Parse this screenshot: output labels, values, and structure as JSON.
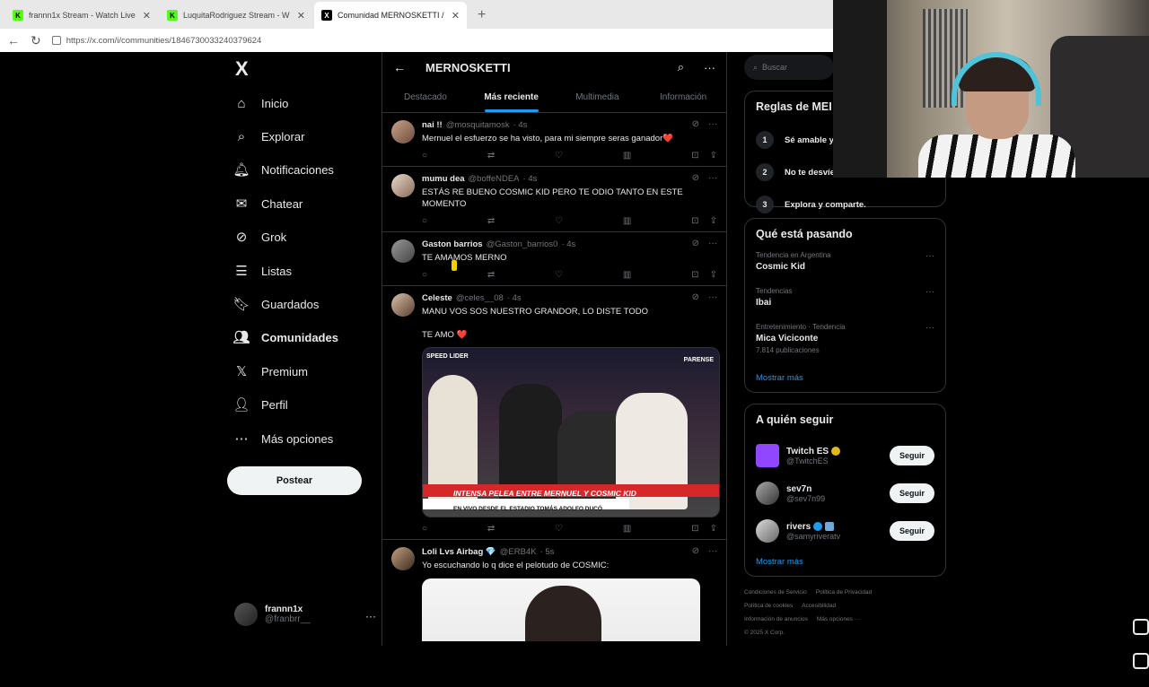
{
  "browser": {
    "tabs": [
      {
        "title": "frannn1x Stream - Watch Live",
        "icon": "kick-icon"
      },
      {
        "title": "LuquitaRodriguez Stream - W",
        "icon": "kick-icon"
      },
      {
        "title": "Comunidad MERNOSKETTI / X",
        "icon": "x-icon"
      }
    ],
    "url": "https://x.com/i/communities/1846730033240379624"
  },
  "sidebar": {
    "logo": "X",
    "items": [
      {
        "label": "Inicio",
        "icon": "home-icon"
      },
      {
        "label": "Explorar",
        "icon": "search-icon"
      },
      {
        "label": "Notificaciones",
        "icon": "bell-icon"
      },
      {
        "label": "Chatear",
        "icon": "mail-icon"
      },
      {
        "label": "Grok",
        "icon": "grok-icon"
      },
      {
        "label": "Listas",
        "icon": "list-icon"
      },
      {
        "label": "Guardados",
        "icon": "bookmark-icon"
      },
      {
        "label": "Comunidades",
        "icon": "communities-icon"
      },
      {
        "label": "Premium",
        "icon": "x-premium-icon"
      },
      {
        "label": "Perfil",
        "icon": "profile-icon"
      },
      {
        "label": "Más opciones",
        "icon": "more-options-icon"
      }
    ],
    "post_label": "Postear",
    "account": {
      "name": "frannn1x",
      "handle": "@franbrr__"
    }
  },
  "main": {
    "title": "MERNOSKETTI",
    "tabs": [
      "Destacado",
      "Más reciente",
      "Multimedia",
      "Información"
    ],
    "tweets": [
      {
        "name": "nai !!",
        "handle": "@mosquitamosk",
        "time": "· 4s",
        "text": "Mernuel el esfuerzo se ha visto, para mi siempre seras ganador❤️"
      },
      {
        "name": "mumu dea",
        "handle": "@boffeNDEA",
        "time": "· 4s",
        "text": "ESTÁS RE BUENO COSMIC KID PERO TE ODIO TANTO EN ESTE MOMENTO"
      },
      {
        "name": "Gaston barrios",
        "handle": "@Gaston_barrios0",
        "time": "· 4s",
        "text": "TE AMAMOS MERNO"
      },
      {
        "name": "Celeste",
        "handle": "@celes__08",
        "time": "· 4s",
        "text": "MANU VOS SOS NUESTRO GRANDOR, LO DISTE TODO",
        "text2": "TE AMO ❤️",
        "media": {
          "banner": "INTENSA PELEA ENTRE MERNUEL Y COSMIC KID",
          "sub": "EN VIVO DESDE EL ESTADIO TOMÁS ADOLFO DUCÓ",
          "logo_left": "SPEED LIDER",
          "logo_right": "PARENSE"
        }
      },
      {
        "name": "Loli Lvs Airbag 💎",
        "handle": "@ERB4K",
        "time": "· 5s",
        "text": "Yo escuchando lo q dice el pelotudo de COSMIC:"
      }
    ]
  },
  "right": {
    "search_placeholder": "Buscar",
    "rules_title": "Reglas de MEI",
    "rules": [
      {
        "n": "1",
        "text": "Sé amable y"
      },
      {
        "n": "2",
        "text": "No te desvíe"
      },
      {
        "n": "3",
        "text": "Explora y comparte."
      }
    ],
    "trends_title": "Qué está pasando",
    "trends": [
      {
        "cat": "Tendencia en Argentina",
        "name": "Cosmic Kid",
        "count": ""
      },
      {
        "cat": "Tendencias",
        "name": "Ibai",
        "count": ""
      },
      {
        "cat": "Entretenimiento · Tendencia",
        "name": "Mica Viciconte",
        "count": "7.814 publicaciones"
      }
    ],
    "show_more": "Mostrar más",
    "follow_title": "A quién seguir",
    "follow": [
      {
        "name": "Twitch ES",
        "handle": "@TwitchES",
        "color": "#9146ff"
      },
      {
        "name": "sev7n",
        "handle": "@sev7n99",
        "color": "#555"
      },
      {
        "name": "rivers",
        "handle": "@samyriveratv",
        "color": "#888"
      }
    ],
    "follow_label": "Seguir",
    "footer": [
      "Condiciones de Servicio",
      "Política de Privacidad",
      "Política de cookies",
      "Accesibilidad",
      "Información de anuncios",
      "Más opciones ···",
      "© 2025 X Corp."
    ]
  }
}
